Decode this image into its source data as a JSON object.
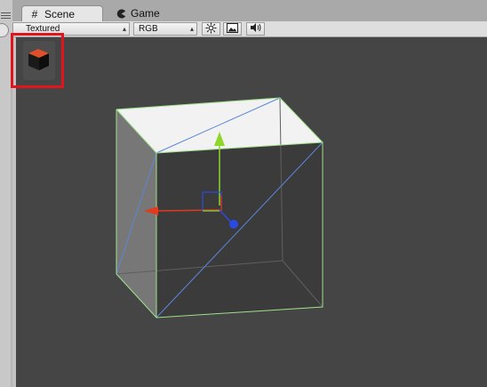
{
  "tabs": [
    {
      "label": "Scene",
      "icon": "grid-icon",
      "active": true
    },
    {
      "label": "Game",
      "icon": "pacman-icon",
      "active": false
    }
  ],
  "toolbar": {
    "render_mode": "Textured",
    "color_mode": "RGB",
    "buttons": [
      "lighting-icon",
      "image-icon",
      "audio-icon"
    ]
  },
  "colors": {
    "highlight_box": "#e1141e",
    "viewport_bg": "#454545",
    "axis_x": "#e23a1c",
    "axis_y": "#8fd62a",
    "axis_z": "#2b4ae0"
  },
  "viewport": {
    "object": "cube",
    "gizmo": "move-tool-gizmo"
  }
}
